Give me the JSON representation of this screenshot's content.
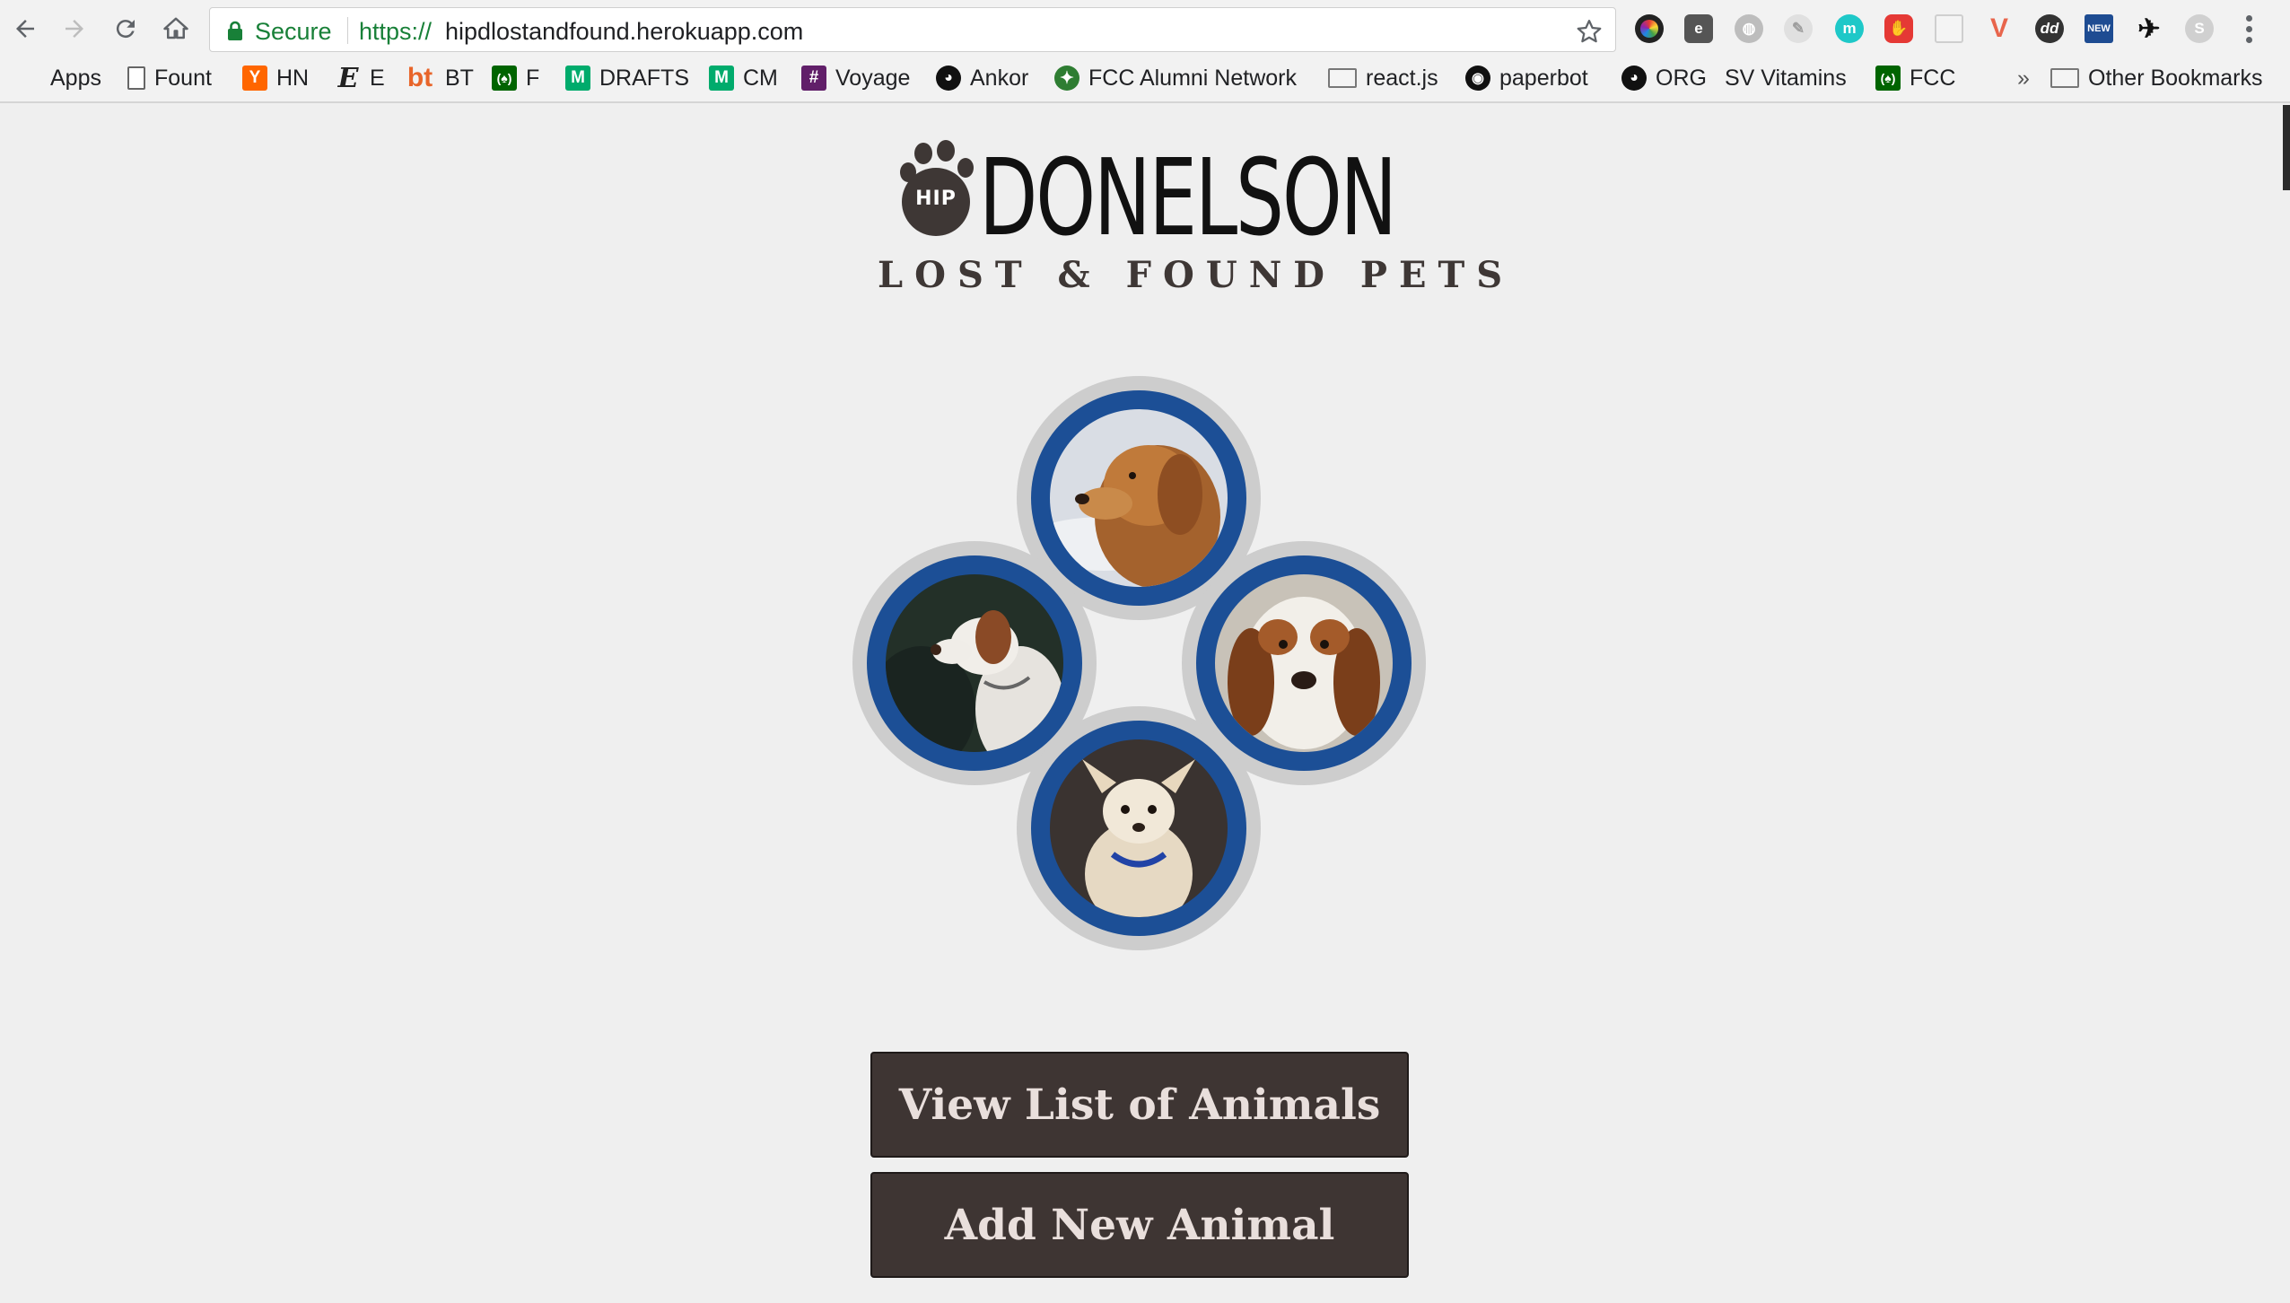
{
  "browser": {
    "secure_label": "Secure",
    "url_scheme": "https://",
    "url_host": "hipdlostandfound.herokuapp.com",
    "extensions": [
      "colorwheel-icon",
      "evernote-icon",
      "globe-icon",
      "leaf-icon",
      "m-icon",
      "adblock-icon",
      "page-icon",
      "v-icon",
      "dd-icon",
      "new-icon",
      "bird-icon",
      "skype-icon"
    ],
    "more_bookmarks": "»",
    "other_bookmarks": "Other Bookmarks"
  },
  "bookmarks": [
    {
      "label": "Apps",
      "icon": "apps-grid-icon"
    },
    {
      "label": "Fount",
      "icon": "page-icon"
    },
    {
      "label": "HN",
      "icon": "hn-icon"
    },
    {
      "label": "E",
      "icon": "e-icon"
    },
    {
      "label": "BT",
      "icon": "bt-icon"
    },
    {
      "label": "F",
      "icon": "fcc-icon"
    },
    {
      "label": "DRAFTS",
      "icon": "medium-icon"
    },
    {
      "label": "CM",
      "icon": "medium-icon"
    },
    {
      "label": "Voyage",
      "icon": "slack-icon"
    },
    {
      "label": "Ankor",
      "icon": "github-icon"
    },
    {
      "label": "FCC Alumni Network",
      "icon": "alumni-icon"
    },
    {
      "label": "react.js",
      "icon": "folder-icon"
    },
    {
      "label": "paperbot",
      "icon": "paperbot-icon"
    },
    {
      "label": "ORG",
      "icon": "github-icon"
    },
    {
      "label": "SV Vitamins",
      "icon": "sv-icon"
    },
    {
      "label": "FCC",
      "icon": "fcc-icon"
    }
  ],
  "page": {
    "logo_badge": "HIP",
    "brand": "DONELSON",
    "tagline": "LOST & FOUND PETS",
    "view_button": "View List of Animals",
    "add_button": "Add New Animal"
  },
  "colors": {
    "page_bg": "#efefef",
    "ring_blue": "#1c4f96",
    "button_bg": "#3e3533",
    "button_text": "#e9dfdc",
    "secure_green": "#188038"
  }
}
